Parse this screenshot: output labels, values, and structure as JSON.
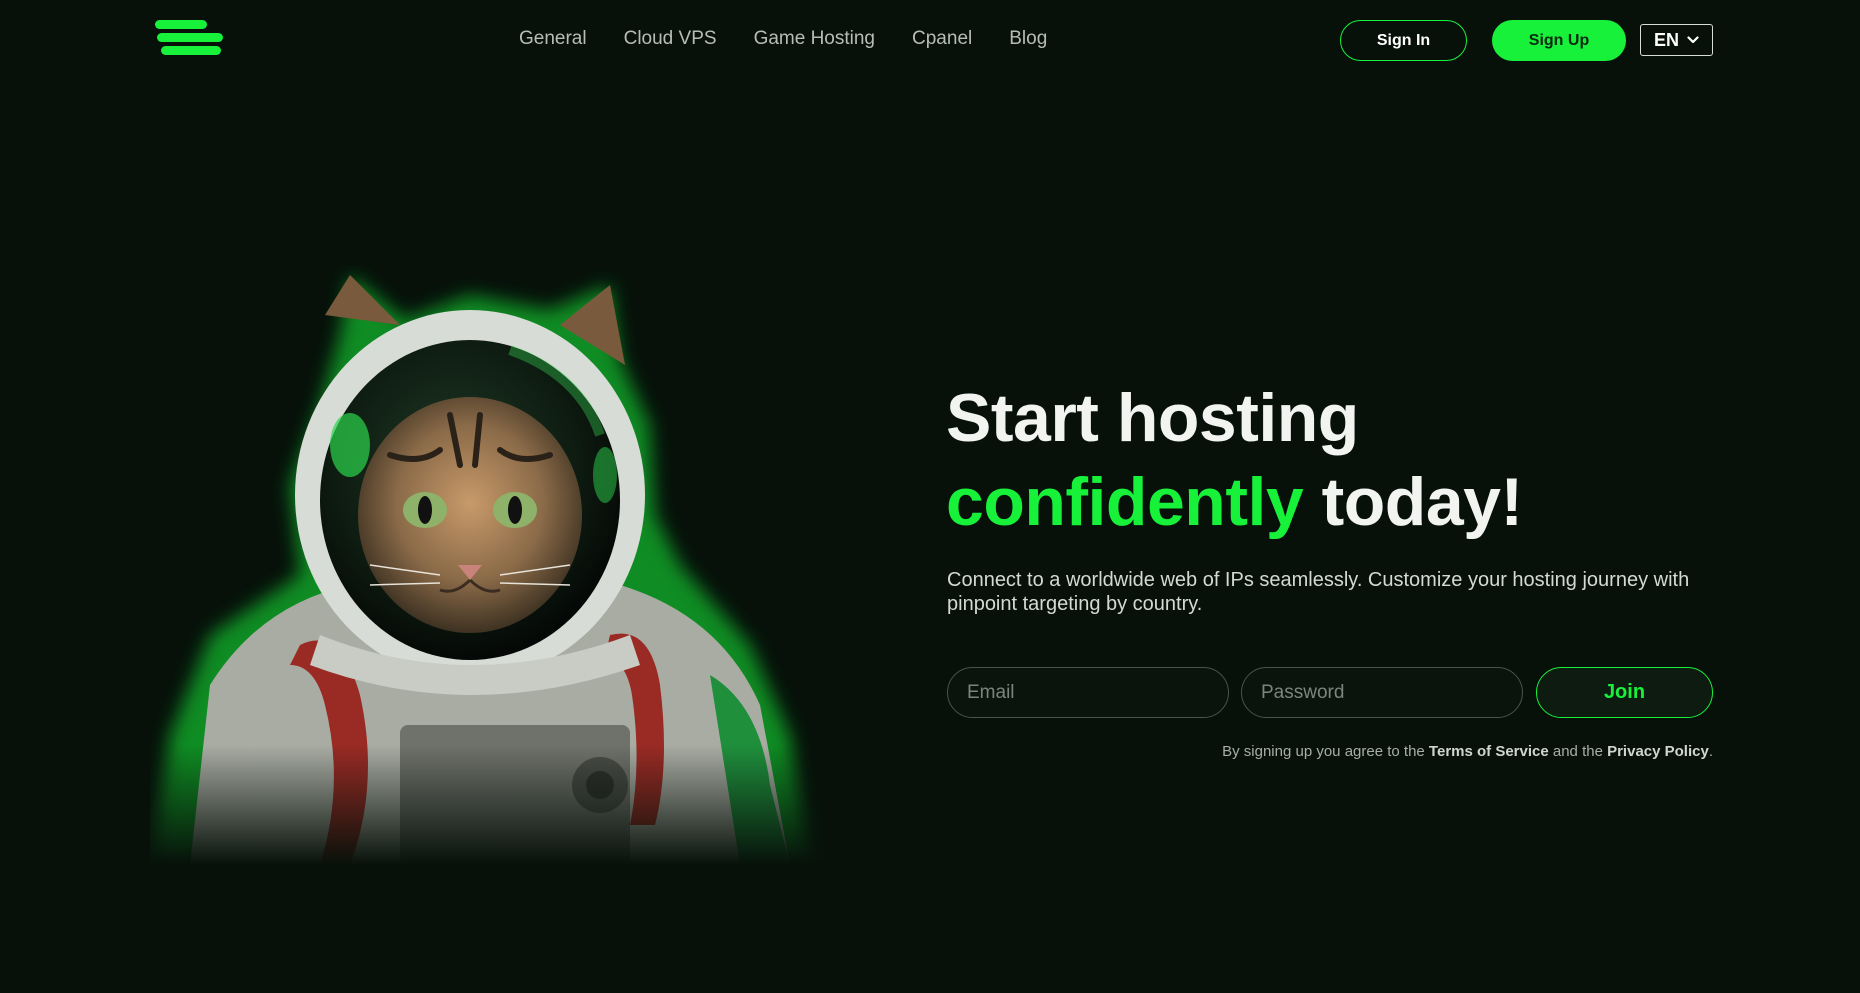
{
  "colors": {
    "background": "#07110a",
    "accent": "#17f139",
    "text": "#e9ece9"
  },
  "header": {
    "logo_icon": "stacked-bars-logo",
    "nav": [
      "General",
      "Cloud VPS",
      "Game Hosting",
      "Cpanel",
      "Blog"
    ],
    "sign_in_label": "Sign In",
    "sign_up_label": "Sign Up",
    "language": "EN",
    "language_icon": "chevron-down-icon"
  },
  "hero": {
    "image": "astronaut-cat-illustration",
    "headline_line1": "Start hosting",
    "headline_accent": "confidently",
    "headline_rest": "today!",
    "subtitle": "Connect to a worldwide web of IPs seamlessly. Customize your hosting journey with pinpoint targeting by country.",
    "email_placeholder": "Email",
    "password_placeholder": "Password",
    "join_label": "Join",
    "terms_prefix": "By signing up you agree to the",
    "terms_link": "Terms of Service",
    "terms_middle": "and the",
    "privacy_link": "Privacy Policy",
    "terms_suffix": "."
  }
}
